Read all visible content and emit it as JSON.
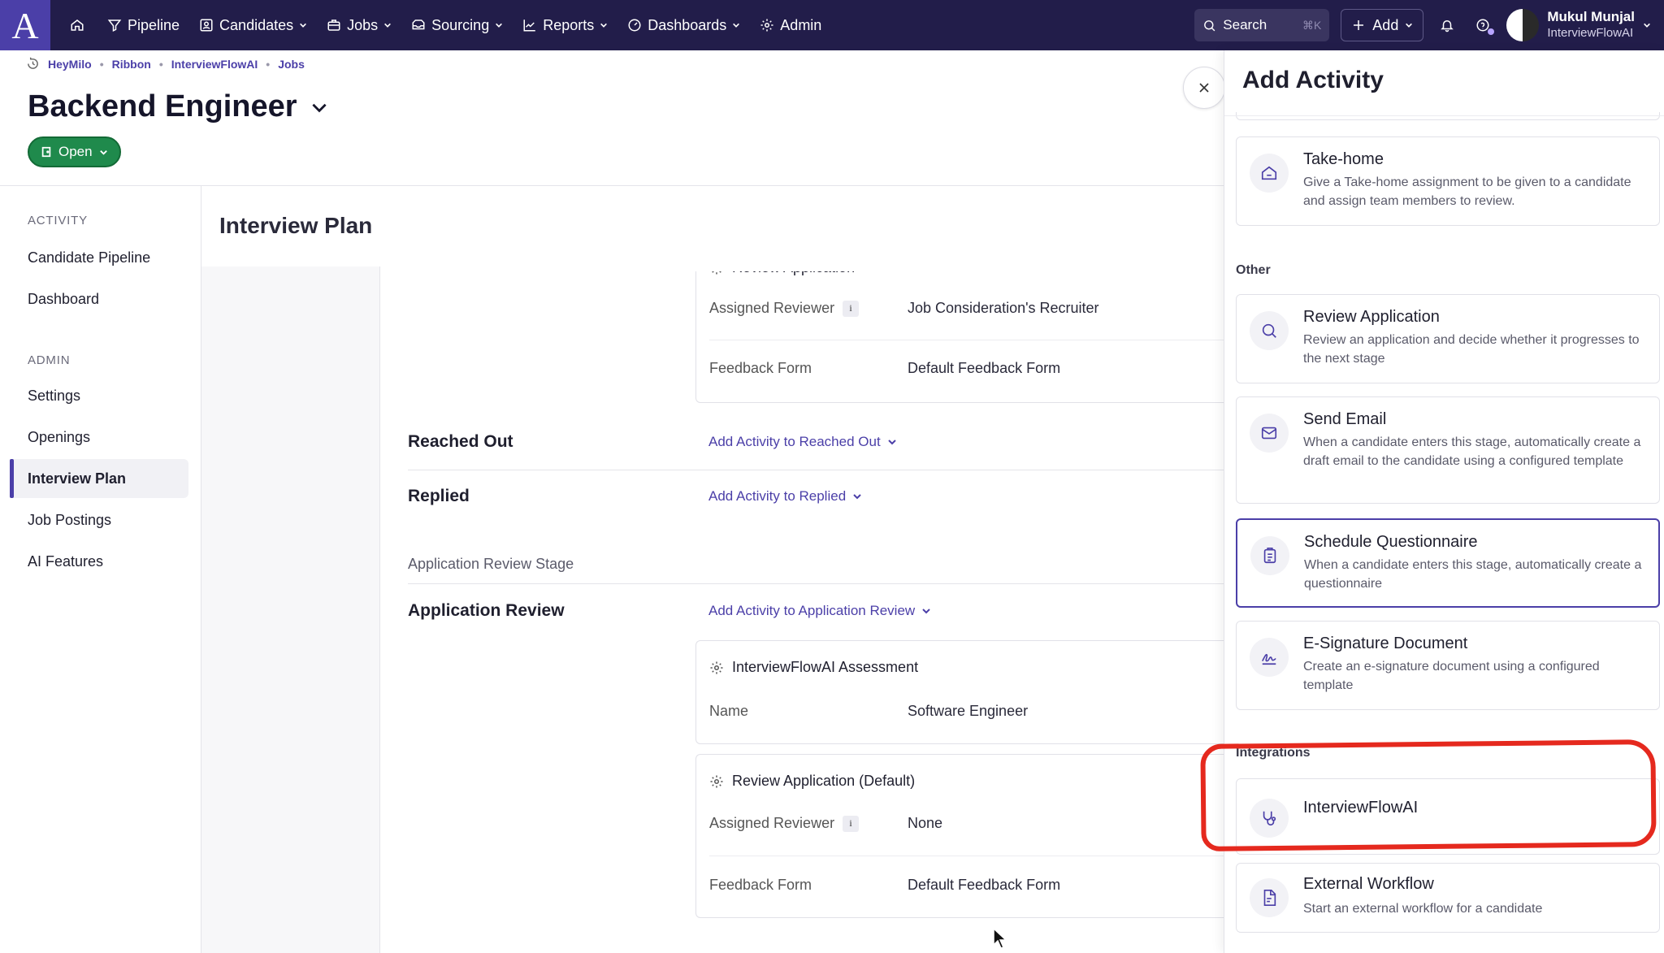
{
  "nav": {
    "logo": "A",
    "items": [
      {
        "label": "Pipeline"
      },
      {
        "label": "Candidates"
      },
      {
        "label": "Jobs"
      },
      {
        "label": "Sourcing"
      },
      {
        "label": "Reports"
      },
      {
        "label": "Dashboards"
      },
      {
        "label": "Admin"
      }
    ],
    "search_label": "Search",
    "search_shortcut": "⌘K",
    "add_label": "Add",
    "user_name": "Mukul Munjal",
    "user_org": "InterviewFlowAI",
    "bg_color": "#221d4a",
    "accent": "#4b3fa8"
  },
  "breadcrumb": [
    "HeyMilo",
    "Ribbon",
    "InterviewFlowAI",
    "Jobs"
  ],
  "job": {
    "title": "Backend Engineer",
    "status": "Open",
    "status_color": "#1f8a4c"
  },
  "sidebar": {
    "activity_heading": "ACTIVITY",
    "activity_items": [
      "Candidate Pipeline",
      "Dashboard"
    ],
    "admin_heading": "ADMIN",
    "admin_items": [
      "Settings",
      "Openings",
      "Interview Plan",
      "Job Postings",
      "AI Features"
    ],
    "active": "Interview Plan"
  },
  "main": {
    "title": "Interview Plan",
    "top_card": {
      "partial_title": "Review Application",
      "fields": [
        {
          "label": "Assigned Reviewer",
          "value": "Job Consideration's Recruiter"
        },
        {
          "label": "Feedback Form",
          "value": "Default Feedback Form"
        }
      ]
    },
    "stages": [
      {
        "name": "Reached Out",
        "add_label": "Add Activity to Reached Out"
      },
      {
        "name": "Replied",
        "add_label": "Add Activity to Replied"
      }
    ],
    "review_stage_label": "Application Review Stage",
    "review_stage": {
      "name": "Application Review",
      "add_label": "Add Activity to Application Review"
    },
    "review_cards": [
      {
        "title": "InterviewFlowAI Assessment",
        "fields": [
          {
            "label": "Name",
            "value": "Software Engineer"
          }
        ]
      },
      {
        "title": "Review Application (Default)",
        "fields": [
          {
            "label": "Assigned Reviewer",
            "value": "None"
          },
          {
            "label": "Feedback Form",
            "value": "Default Feedback Form"
          }
        ]
      }
    ],
    "info_glyph": "i"
  },
  "drawer": {
    "title": "Add Activity",
    "takehome": {
      "title": "Take-home",
      "desc": "Give a Take-home assignment to be given to a candidate and assign team members to review."
    },
    "other_label": "Other",
    "other": [
      {
        "title": "Review Application",
        "desc": "Review an application and decide whether it progresses to the next stage",
        "icon": "search-icon"
      },
      {
        "title": "Send Email",
        "desc": "When a candidate enters this stage, automatically create a draft email to the candidate using a configured template",
        "icon": "mail-icon"
      },
      {
        "title": "Schedule Questionnaire",
        "desc": "When a candidate enters this stage, automatically create a questionnaire",
        "icon": "clipboard-icon"
      },
      {
        "title": "E-Signature Document",
        "desc": "Create an e-signature document using a configured template",
        "icon": "signature-icon"
      }
    ],
    "integrations_label": "Integrations",
    "integrations": [
      {
        "title": "InterviewFlowAI",
        "desc": "",
        "icon": "stethoscope-icon"
      },
      {
        "title": "External Workflow",
        "desc": "Start an external workflow for a candidate",
        "icon": "document-icon"
      }
    ],
    "highlight_color": "#e5291e"
  }
}
